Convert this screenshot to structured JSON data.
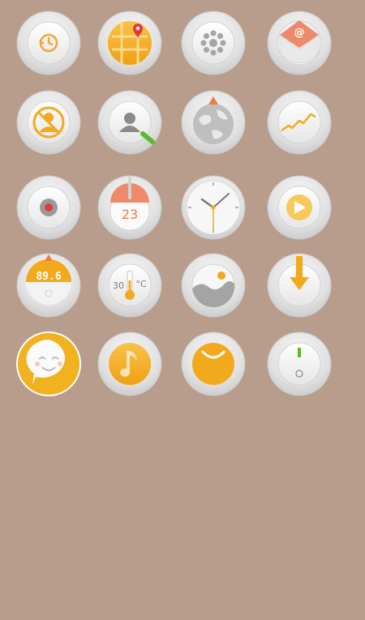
{
  "icons": [
    {
      "id": "history",
      "glyph": "history-icon"
    },
    {
      "id": "map",
      "glyph": "map-pin-icon"
    },
    {
      "id": "speaker",
      "glyph": "speaker-grill-icon"
    },
    {
      "id": "email",
      "glyph": "email-envelope-icon"
    },
    {
      "id": "block-contact",
      "glyph": "blocked-person-icon"
    },
    {
      "id": "contact-edit",
      "glyph": "person-pencil-icon"
    },
    {
      "id": "globe",
      "glyph": "globe-icon"
    },
    {
      "id": "stocks",
      "glyph": "trend-chart-icon"
    },
    {
      "id": "record",
      "glyph": "record-dot-icon"
    },
    {
      "id": "calendar",
      "glyph": "calendar-icon",
      "day": "23"
    },
    {
      "id": "clock",
      "glyph": "clock-icon"
    },
    {
      "id": "play",
      "glyph": "play-icon"
    },
    {
      "id": "radio",
      "glyph": "radio-tuner-icon",
      "frequency": "89.6"
    },
    {
      "id": "weather",
      "glyph": "thermometer-icon",
      "temperature": "30",
      "unit": "°C"
    },
    {
      "id": "gallery",
      "glyph": "landscape-photo-icon"
    },
    {
      "id": "download",
      "glyph": "download-arrow-icon"
    },
    {
      "id": "chat",
      "glyph": "smiley-chat-icon"
    },
    {
      "id": "music",
      "glyph": "music-note-icon"
    },
    {
      "id": "shop",
      "glyph": "shopping-bag-icon"
    },
    {
      "id": "power",
      "glyph": "power-switch-icon"
    }
  ],
  "colors": {
    "background": "#b89c8c",
    "accent": "#f3a91c",
    "accent_light": "#f9c95a",
    "salmon": "#ee8a6a",
    "red": "#e23a3a",
    "green": "#5cb82e",
    "plate": "#e4e4e4",
    "plate_dark": "#c8c8c8",
    "inner": "#f3f3f3",
    "gray_glyph": "#8f8f8f"
  }
}
